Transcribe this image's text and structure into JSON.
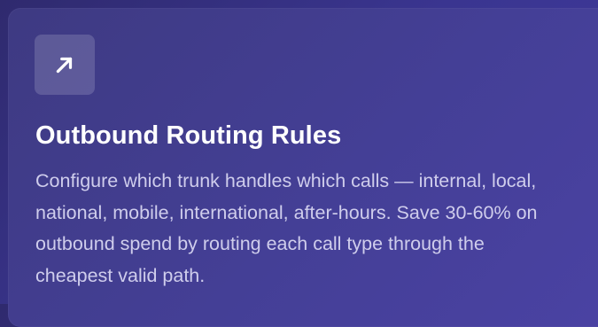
{
  "card": {
    "icon": "arrow-up-right-icon",
    "title": "Outbound Routing Rules",
    "description": "Configure which trunk handles which calls — internal, local, national, mobile, international, after-hours. Save 30-60% on outbound spend by routing each call type through the cheapest valid path."
  },
  "colors": {
    "background": "#2f2a6e",
    "card": "#443f96",
    "title": "#ffffff",
    "description": "#cfcdec"
  }
}
